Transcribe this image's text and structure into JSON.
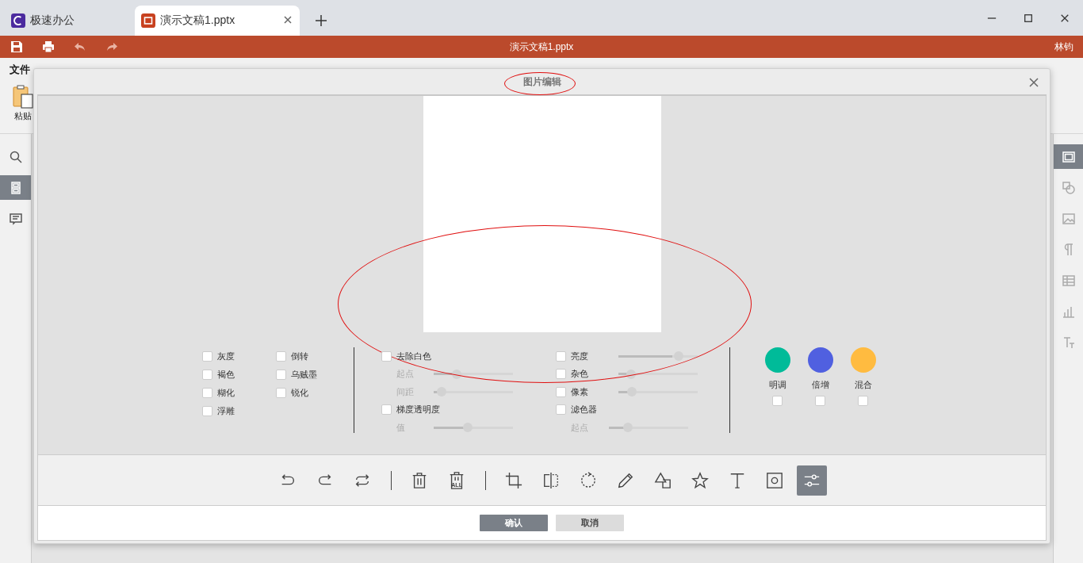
{
  "app_tabs": [
    {
      "label": "极速办公",
      "selected": false
    },
    {
      "label": "演示文稿1.pptx",
      "selected": true
    }
  ],
  "toolbar": {
    "title": "演示文稿1.pptx",
    "user": "林钧"
  },
  "ribbon": {
    "menu": [
      {
        "label": "文件"
      }
    ],
    "paste": {
      "label": "粘贴"
    }
  },
  "left_sidebar": [
    {
      "selected": false
    },
    {
      "selected": true
    },
    {
      "selected": false
    }
  ],
  "right_sidebar": [
    {
      "selected": true
    },
    {
      "selected": false
    },
    {
      "selected": false
    },
    {
      "selected": false
    },
    {
      "selected": false
    },
    {
      "selected": false
    },
    {
      "selected": false
    }
  ],
  "dialog": {
    "title": "图片编辑",
    "effect_checks": [
      {
        "label": "灰度",
        "checked": false
      },
      {
        "label": "倒转",
        "checked": false
      },
      {
        "label": "褐色",
        "checked": false
      },
      {
        "label": "乌贼墨",
        "checked": false
      },
      {
        "label": "糊化",
        "checked": false
      },
      {
        "label": "锐化",
        "checked": false
      },
      {
        "label": "浮雕",
        "checked": false
      }
    ],
    "filter_column": [
      {
        "kind": "check",
        "label": "去除白色",
        "checked": false
      },
      {
        "kind": "slider",
        "label": "起点",
        "level": 0.26
      },
      {
        "kind": "slider",
        "label": "间距",
        "level": 0.09
      },
      {
        "kind": "check",
        "label": "梯度透明度",
        "checked": false
      },
      {
        "kind": "slider",
        "label": "值",
        "level": 0.39
      }
    ],
    "adjust_column": [
      {
        "kind": "check_slider",
        "label": "亮度",
        "checked": false,
        "level": 0.68
      },
      {
        "kind": "check_slider",
        "label": "杂色",
        "checked": false,
        "level": 0.15
      },
      {
        "kind": "check_slider",
        "label": "像素",
        "checked": false,
        "level": 0.16
      },
      {
        "kind": "check",
        "label": "滤色器",
        "checked": false
      },
      {
        "kind": "slider",
        "label": "起点",
        "level": 0.22
      }
    ],
    "blends": [
      {
        "label": "明调",
        "color": "#00bb99",
        "checked": false
      },
      {
        "label": "倍增",
        "color": "#5060e0",
        "checked": false
      },
      {
        "label": "混合",
        "color": "#ffbb40",
        "checked": false
      }
    ],
    "tool_groups": [
      {
        "tools": [
          {
            "selected": false
          },
          {
            "selected": false
          },
          {
            "selected": false
          }
        ]
      },
      {
        "tools": [
          {
            "selected": false
          },
          {
            "selected": false,
            "label": "ALL"
          }
        ]
      },
      {
        "tools": [
          {
            "selected": false
          },
          {
            "selected": false
          },
          {
            "selected": false
          },
          {
            "selected": false
          },
          {
            "selected": false
          },
          {
            "selected": false
          },
          {
            "selected": false
          },
          {
            "selected": false
          },
          {
            "selected": true
          }
        ]
      }
    ],
    "buttons": [
      {
        "label": "确认",
        "kind": "primary"
      },
      {
        "label": "取消",
        "kind": "secondary"
      }
    ]
  },
  "annotations": [
    {
      "kind": "ellipse"
    },
    {
      "kind": "ellipse"
    }
  ]
}
